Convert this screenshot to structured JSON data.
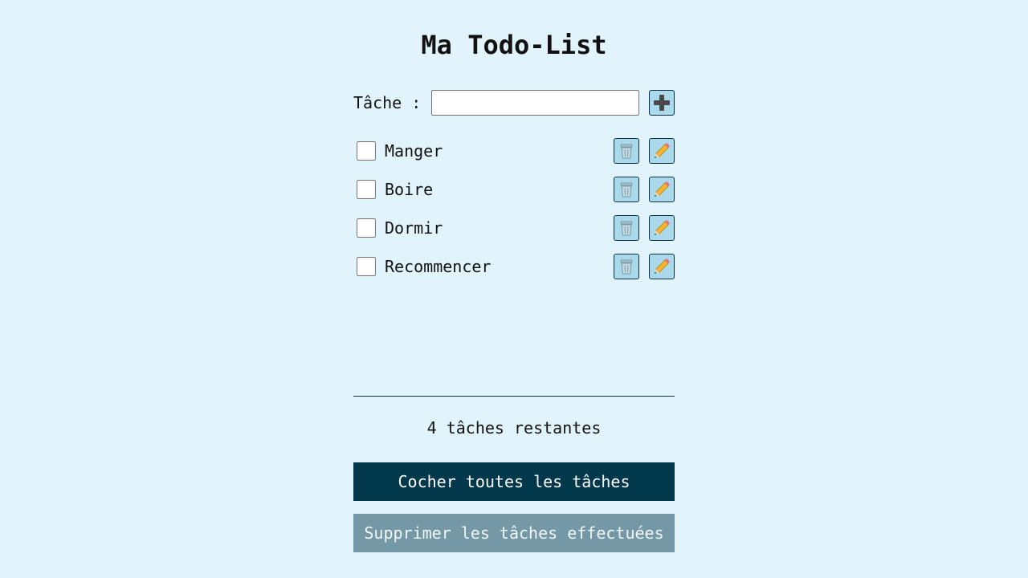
{
  "title": "Ma Todo-List",
  "add": {
    "label": "Tâche :",
    "value": "",
    "placeholder": ""
  },
  "icons": {
    "add": "plus-icon",
    "delete": "trash-icon",
    "edit": "pencil-icon"
  },
  "tasks": [
    {
      "label": "Manger",
      "done": false
    },
    {
      "label": "Boire",
      "done": false
    },
    {
      "label": "Dormir",
      "done": false
    },
    {
      "label": "Recommencer",
      "done": false
    }
  ],
  "remaining": "4 tâches restantes",
  "buttons": {
    "check_all": "Cocher toutes les tâches",
    "delete_done": "Supprimer les tâches effectuées"
  },
  "colors": {
    "background": "#e2f4fb",
    "primary_button": "#02384c",
    "secondary_button": "#7498a5",
    "icon_button": "#a9d9ea"
  }
}
